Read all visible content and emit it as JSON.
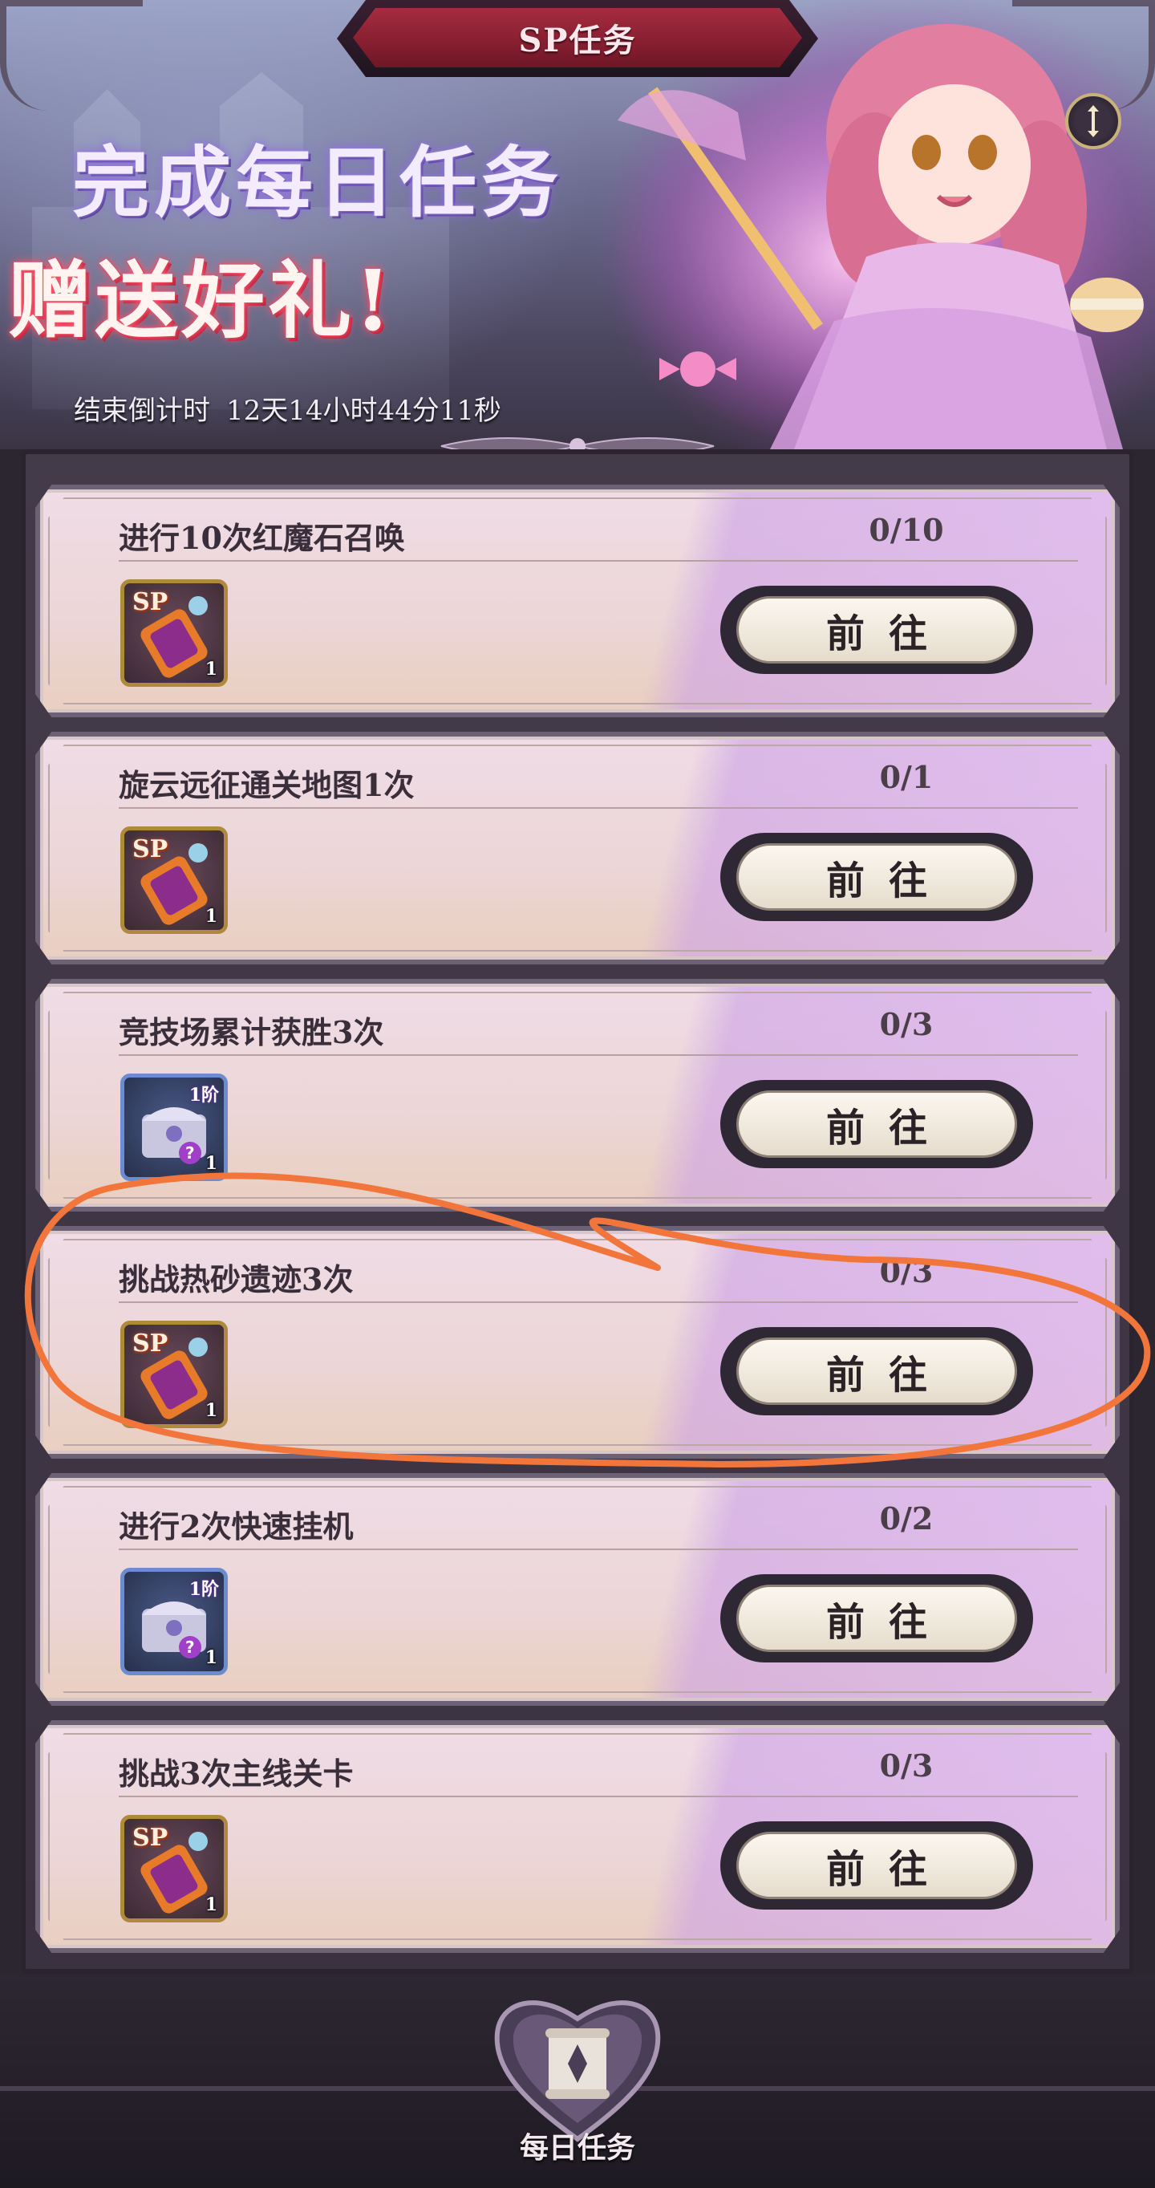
{
  "header": {
    "title": "SP任务",
    "headline": "完成每日任务",
    "subheadline": "赠送好礼!",
    "countdown_label": "结束倒计时",
    "countdown_value": "12天14小时44分11秒"
  },
  "tasks": [
    {
      "title": "进行10次红魔石召唤",
      "progress": "0/10",
      "reward": {
        "type": "sp-scroll",
        "badge": "SP",
        "count": "1"
      },
      "button": "前往"
    },
    {
      "title": "旋云远征通关地图1次",
      "progress": "0/1",
      "reward": {
        "type": "sp-scroll",
        "badge": "SP",
        "count": "1"
      },
      "button": "前往"
    },
    {
      "title": "竞技场累计获胜3次",
      "progress": "0/3",
      "reward": {
        "type": "mystery-chest",
        "badge": "1阶",
        "count": "1"
      },
      "button": "前往"
    },
    {
      "title": "挑战热砂遗迹3次",
      "progress": "0/3",
      "reward": {
        "type": "sp-scroll",
        "badge": "SP",
        "count": "1"
      },
      "button": "前往"
    },
    {
      "title": "进行2次快速挂机",
      "progress": "0/2",
      "reward": {
        "type": "mystery-chest",
        "badge": "1阶",
        "count": "1"
      },
      "button": "前往"
    },
    {
      "title": "挑战3次主线关卡",
      "progress": "0/3",
      "reward": {
        "type": "sp-scroll",
        "badge": "SP",
        "count": "1"
      },
      "button": "前往"
    }
  ],
  "bottom_nav": {
    "label": "每日任务",
    "icon": "scroll-icon"
  },
  "annotation": {
    "color": "#f2763c",
    "highlights_task": 3
  }
}
